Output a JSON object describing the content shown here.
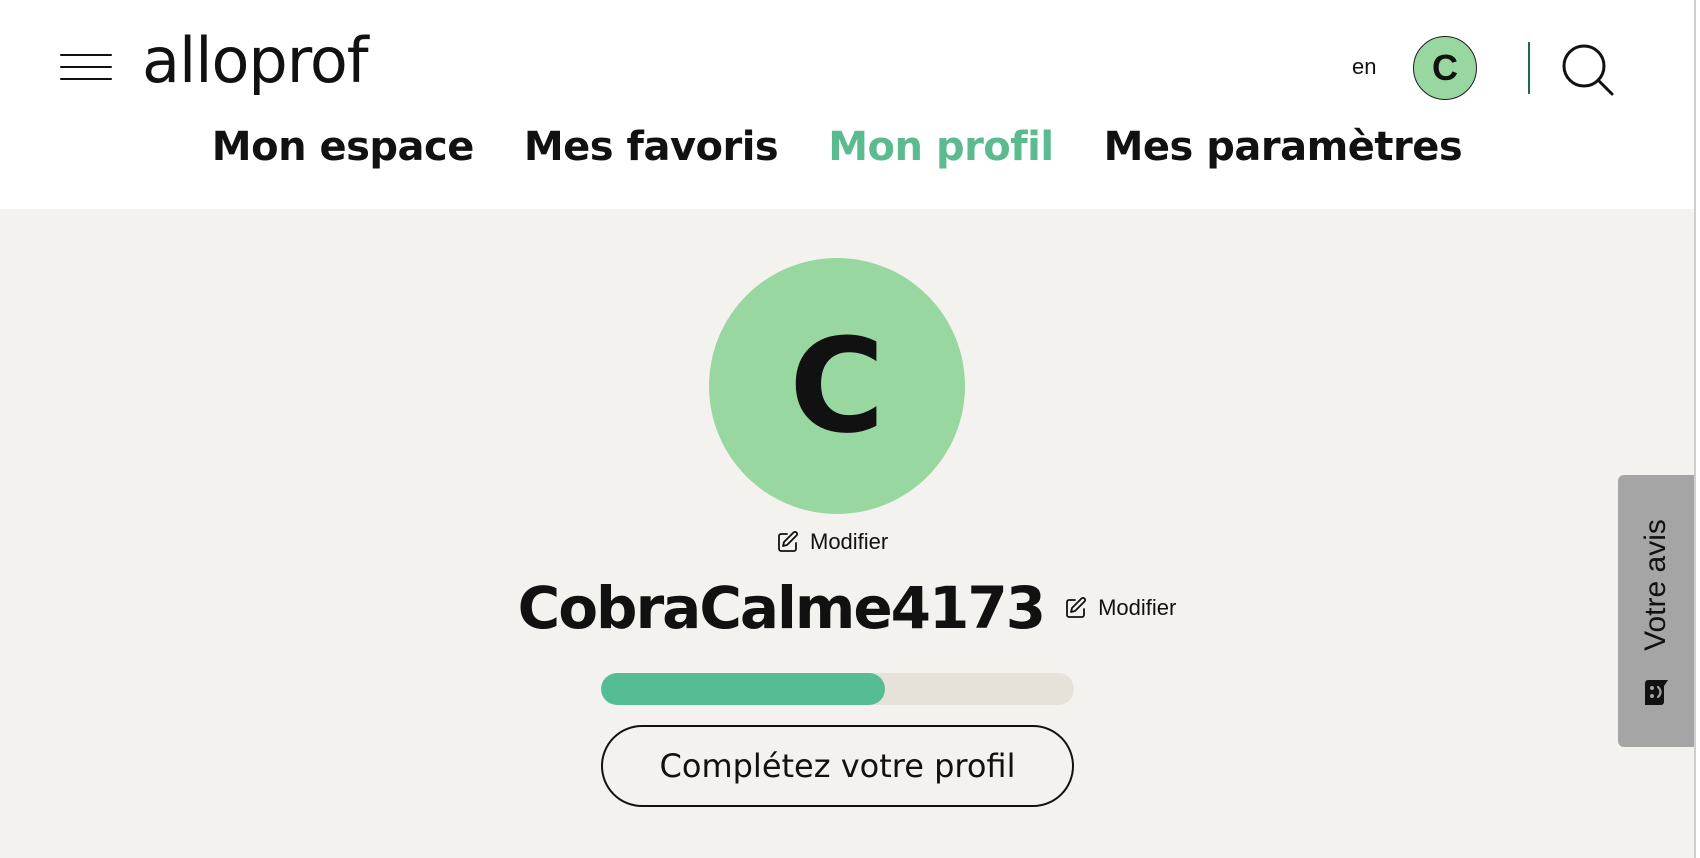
{
  "header": {
    "logo_text": "alloprof",
    "language_toggle": "en",
    "user_initial": "C",
    "nav": [
      {
        "label": "Mon espace",
        "active": false
      },
      {
        "label": "Mes favoris",
        "active": false
      },
      {
        "label": "Mon profil",
        "active": true
      },
      {
        "label": "Mes paramètres",
        "active": false
      }
    ]
  },
  "profile": {
    "avatar_initial": "C",
    "edit_photo_label": "Modifier",
    "username": "CobraCalme4173",
    "edit_username_label": "Modifier",
    "completion_percent": 60,
    "complete_profile_button": "Complétez votre profil"
  },
  "feedback_tab": {
    "label": "Votre avis"
  },
  "colors": {
    "accent_green": "#56bc93",
    "active_nav": "#5bba90",
    "avatar_green": "#98d7a0",
    "background": "#f3f2ee",
    "progress_track": "#e6e1d9",
    "feedback_tab": "#a5a5a5"
  },
  "icons": {
    "menu": "hamburger-icon",
    "search": "search-icon",
    "edit": "pencil-square-icon",
    "feedback": "smiley-chat-icon"
  }
}
